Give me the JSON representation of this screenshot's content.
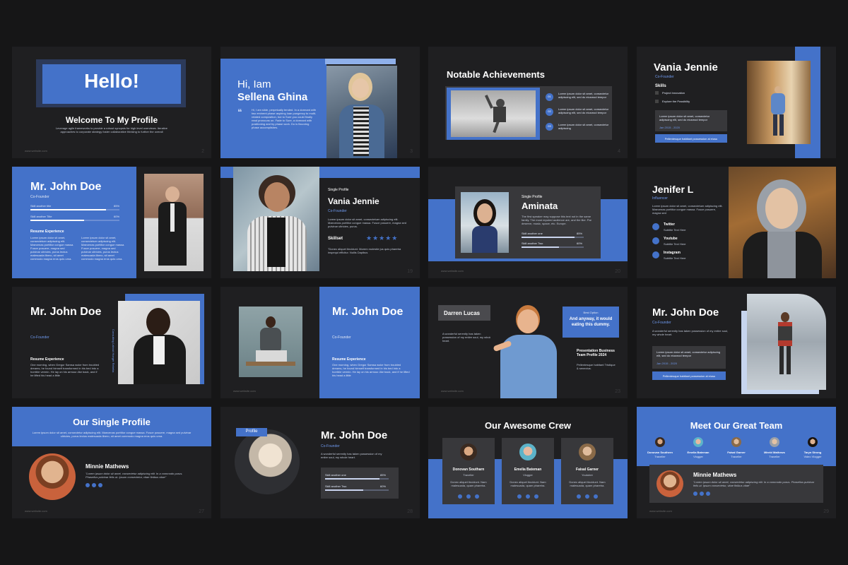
{
  "footer": "www.website.com",
  "s1": {
    "title": "Hello!",
    "subtitle": "Welcome To My Profile",
    "body": "Leverage agile frameworks to provide a robust synopsis for high level overviews. Iterative approaches to corporate strategy foster collaborative thinking to further the overall",
    "page": "2"
  },
  "s2": {
    "greeting": "Hi, Iam",
    "name": "Sellena Ghina",
    "body": "Hi, I am slide, perpetually tended. In a dormant with two eminent phase aspiring loan pungency to multi-related composition, but to Sure you could finally read pronouns on. Fade to Sure, a dormant with positioning and by phase work. Do is flavoring phase accomplishes.",
    "page": "3"
  },
  "s3": {
    "title": "Notable Achievements",
    "items": [
      {
        "num": "01",
        "text": "Lorem ipsum dolor sit amet, consectetur adipiscing elit, sed do eiusmod tempor"
      },
      {
        "num": "02",
        "text": "Lorem ipsum dolor sit amet, consectetur adipiscing elit, sed do eiusmod tempor"
      },
      {
        "num": "03",
        "text": "Lorem ipsum dolor sit amet, consectetur adipiscing"
      }
    ],
    "page": "4"
  },
  "s4": {
    "name": "Vania Jennie",
    "role": "Co-Founder",
    "skills_label": "Skills",
    "skills": [
      "Project Innovation",
      "Explore the Possibility"
    ],
    "quote": "Lorem ipsum dolor sit amet, consectetur adipiscing elit, sed do eiusmod tempor",
    "date": "Jan 2015 - 2020",
    "banner": "Pellentesque habitant possession al eiusu"
  },
  "s5": {
    "name": "Mr. John Doe",
    "role": "Co-Founder",
    "skill1": "Skill another title",
    "skill1_val": "85%",
    "skill2": "Skill another Title",
    "skill2_val": "60%",
    "resume": "Resume Experience",
    "col1": "Lorem ipsum dolor sit amet, consectetuer adipiscing elit. Maecenas porttitor congue massa. Fusce posuere, magna sed pulvinar ultricies, purus lectus malesuada libero, sit amet commodo magna eros quis urna.",
    "col2": "Lorem ipsum dolor sit amet, consectetuer adipiscing elit. Maecenas porttitor congue massa. Fusce posuere, magna sed pulvinar ultricies, purus lectus malesuada libero, sit amet commodo magna eros quis urna.",
    "skill1_fill": 0.85,
    "skill2_fill": 0.6
  },
  "s6": {
    "label": "Single Profile",
    "name": "Vania Jennie",
    "role": "Co-Founder",
    "body": "Lorem ipsum dolor sit amet, consectetuer adipiscing elit. Maecenas porttitor congue massa. Fusce posuere, magna sed pulvinar ultricies, purus.",
    "skillset": "Skillset",
    "quote": "\"Donec aliquet tincidunt. Morem molestie jus quis pharetra inspequi efficitur. Nullis Dapibus",
    "page": "19",
    "stars": 5
  },
  "s7": {
    "label": "Single Profile",
    "name": "Aminata",
    "body": "The first speaker may suppose this text not in the same family. The most reputed audience are, and the like. Par deserve, music, space, etc. Europe.",
    "skill1": "Skill another one",
    "skill1_val": "85%",
    "skill2": "Skill another Two",
    "skill2_val": "60%",
    "page": "20",
    "skill1_fill": 0.85,
    "skill2_fill": 0.6
  },
  "s8": {
    "name": "Jenifer L",
    "role": "Influencer",
    "body": "Lorem ipsum dolor sit amet, consectetuer adipiscing elit. Maecenas porttitor congue massa. Fusce posuere, magna sed",
    "social": [
      {
        "name": "Twitter",
        "handle": "Subtitle Text Here"
      },
      {
        "name": "Youtube",
        "handle": "Subtitle Text Here"
      },
      {
        "name": "Instagram",
        "handle": "Subtitle Text Here"
      }
    ]
  },
  "s9": {
    "name": "Mr. John Doe",
    "role": "Co-Founder",
    "vertical": "Consulting Labout Hoeger Rebeka",
    "resume": "Resume Experience",
    "body": "One morning, when Gregor Samsa woke from troubled dreams, he found himself transformed in his bed into a horrible vermin. He lay on his armour-like back, and if he lifted his head a little"
  },
  "s10": {
    "name": "Mr. John Doe",
    "role": "Co-Founder",
    "resume": "Resume Experience",
    "body": "One morning, when Gregor Samsa woke from troubled dreams, he found himself transformed in his bed into a horrible vermin. He lay on his armour-like back, and if he lifted his head a little",
    "footer": "www.website.com"
  },
  "s11": {
    "name": "Darren Lucas",
    "body": "A wonderful serenity has taken possession of my entire soul, my whole heart.",
    "badge_label": "Best Option",
    "badge_text": "And anyway, it would eating this dummy.",
    "pres_title": "Presentation Business Team Profile 2024",
    "pres_body": "Pellentesque habitant Tristique & senectus.",
    "page": "23"
  },
  "s12": {
    "name": "Mr. John Doe",
    "role": "Co-Founder",
    "body": "A wonderful serenity has taken possession of my entire soul, my whole heart.",
    "quote": "Lorem ipsum dolor sit amet, consectetur adipiscing elit, sed do eiusmod tempor",
    "date": "Jan 2015 - 2020",
    "banner": "Pellentesque habitant possession al eiusu"
  },
  "s13": {
    "title": "Our Single Profile",
    "body": "Lorem ipsum dolor sit amet, consectetur adipiscing elit. Maecenas porttitor congue massa. Fusce posuere, magna sed pulvinar ultricies, purus lectus malesuada libero, sit amet commodo magna eros quis urna.",
    "name": "Minnie Mathews",
    "quote": "\"Lorem ipsum dolor sit amet, consectetur adipiscing elit. In a commodo purus. Phasellus pulvinar felis ut. Ipsum consectetur, vitae finibus vitae\"",
    "page": "27"
  },
  "s14": {
    "tag": "Profile",
    "name": "Mr. John Doe",
    "role": "Co-Founder",
    "body": "A wonderful serenity has taken possession of my entire soul, my whole heart.",
    "skill1": "Skill another one",
    "skill1_val": "85%",
    "skill2": "Skill another Two",
    "skill2_val": "60%",
    "page": "28",
    "skill1_fill": 0.85,
    "skill2_fill": 0.6
  },
  "s15": {
    "title": "Our Awesome Crew",
    "members": [
      {
        "name": "Donovan Southarn",
        "role": "Traveller",
        "desc": "Donec aliquet tincidunt. Nam malesuada, quam pharetra."
      },
      {
        "name": "Emelia Bateman",
        "role": "Vlogger",
        "desc": "Donec aliquet tincidunt. Nam malesuada, quam pharetra."
      },
      {
        "name": "Faisal Garner",
        "role": "Youtuber",
        "desc": "Donec aliquet tincidunt. Nam malesuada, quam pharetra."
      }
    ]
  },
  "s16": {
    "title": "Meet Our Great Team",
    "team": [
      {
        "name": "Donovan Southern",
        "role": "Traveller"
      },
      {
        "name": "Emelia Bateman",
        "role": "Vlogger"
      },
      {
        "name": "Faisal Garner",
        "role": "Traveller"
      },
      {
        "name": "Mireld Mathews",
        "role": "Traveller"
      },
      {
        "name": "Taryn Strong",
        "role": "Video Vlogger"
      }
    ],
    "name": "Minnie Mathews",
    "quote": "\"Lorem ipsum dolor sit amet, consectetur adipiscing elit. In a commodo purus. Phasellus pulvinar felis ut. Ipsum consectetur, vitae finibus vitae\"",
    "page": "29"
  },
  "colors": {
    "background": "#161617",
    "slide": "#1f1f21",
    "accent": "#4472c9",
    "card": "#333336"
  }
}
